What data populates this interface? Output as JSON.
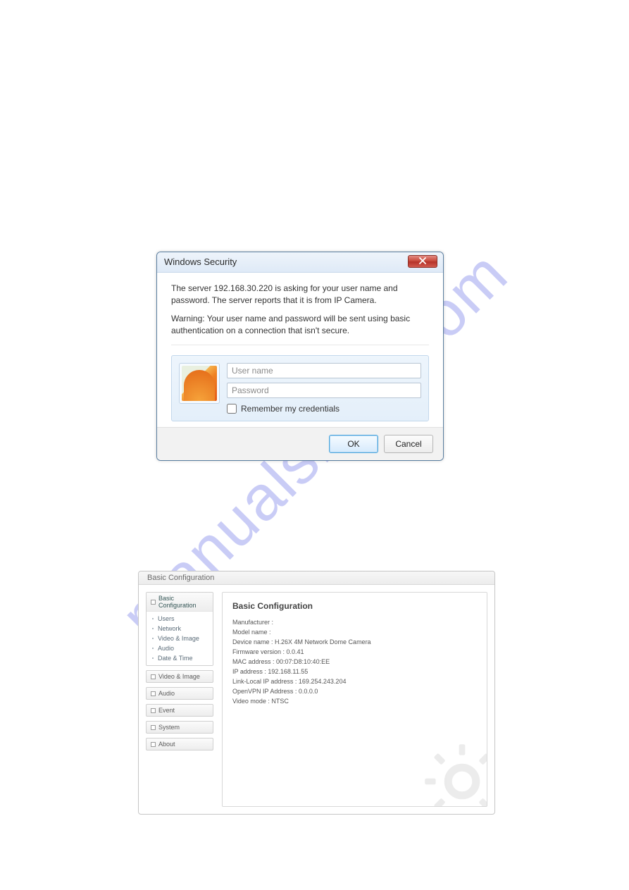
{
  "watermark": "manualshive.com",
  "dialog": {
    "title": "Windows Security",
    "message1": "The server 192.168.30.220 is asking for your user name and password. The server reports that it is from IP Camera.",
    "message2": "Warning: Your user name and password will be sent using basic authentication on a connection that isn't secure.",
    "username_placeholder": "User name",
    "password_placeholder": "Password",
    "remember_label": "Remember my credentials",
    "ok_label": "OK",
    "cancel_label": "Cancel"
  },
  "config": {
    "header": "Basic Configuration",
    "sidebar": {
      "basic": {
        "label": "Basic Configuration",
        "items": [
          "Users",
          "Network",
          "Video & Image",
          "Audio",
          "Date & Time"
        ]
      },
      "groups": [
        "Video & Image",
        "Audio",
        "Event",
        "System",
        "About"
      ]
    },
    "content": {
      "title": "Basic Configuration",
      "fields": [
        {
          "label": "Manufacturer",
          "value": ""
        },
        {
          "label": "Model name",
          "value": ""
        },
        {
          "label": "Device name",
          "value": "H.26X 4M Network Dome Camera"
        },
        {
          "label": "Firmware version",
          "value": "0.0.41"
        },
        {
          "label": "MAC address",
          "value": "00:07:D8:10:40:EE"
        },
        {
          "label": "IP address",
          "value": "192.168.11.55"
        },
        {
          "label": "Link-Local IP address",
          "value": "169.254.243.204"
        },
        {
          "label": "OpenVPN IP Address",
          "value": "0.0.0.0"
        },
        {
          "label": "Video mode",
          "value": "NTSC"
        }
      ]
    }
  }
}
